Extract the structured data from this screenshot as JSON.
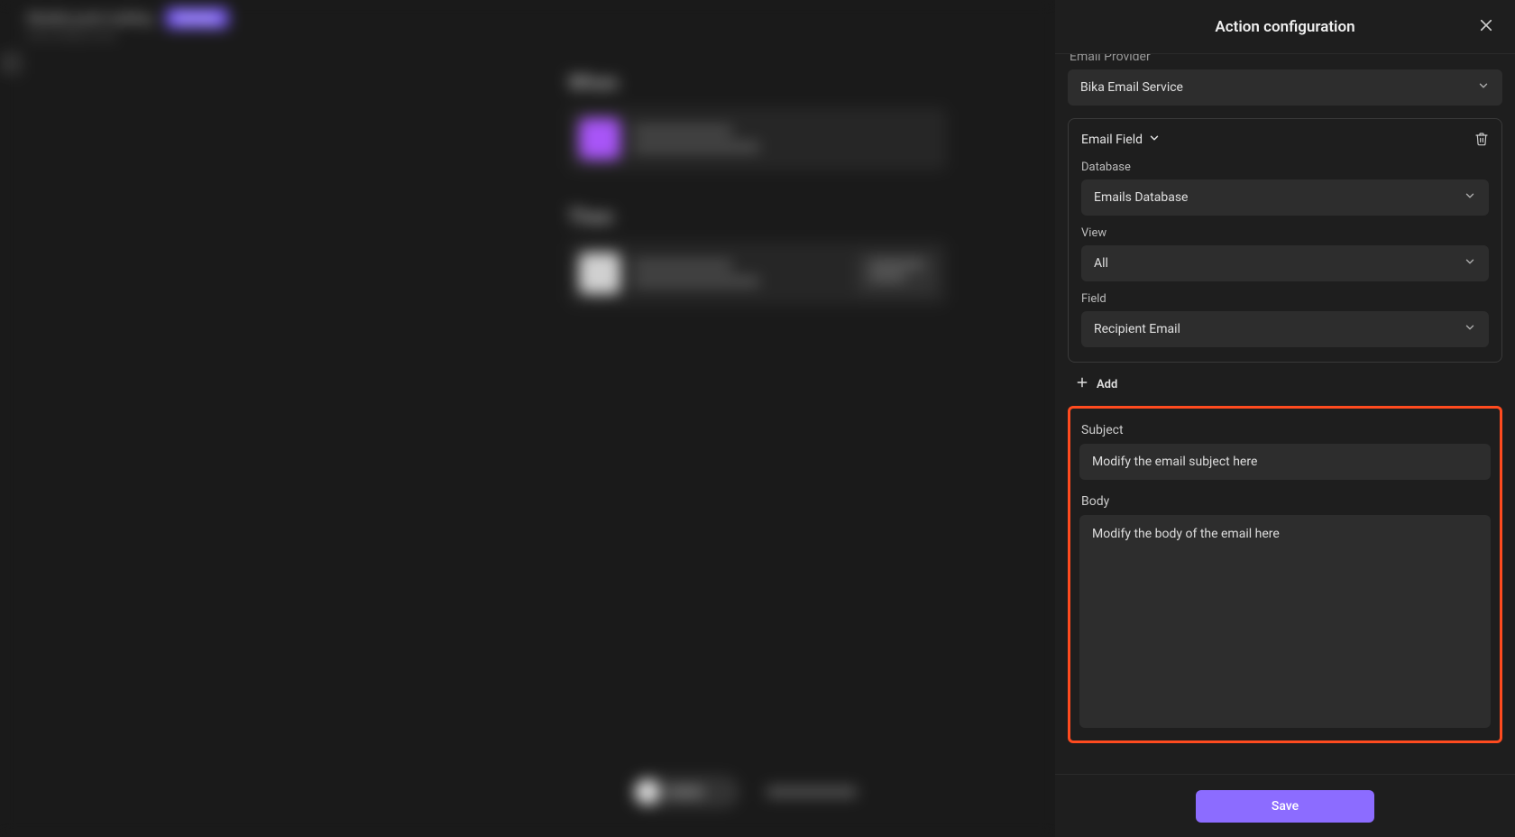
{
  "background": {
    "title": "Weekly push mailing",
    "badge": "Running",
    "subtitle": "Send weekly email",
    "section1": "When",
    "card1_line1": "Schedule Time",
    "card1_line2": "Every Friday",
    "section2": "Then",
    "card2_line1": "Send Email",
    "card2_line2": "Send Bulk Email",
    "card2_pill1": "Configure",
    "toggle": "ON",
    "bottom_text": "History"
  },
  "panel": {
    "title": "Action configuration",
    "email_provider_label": "Email Provider",
    "email_provider_value": "Bika Email Service",
    "field_box": {
      "header": "Email Field",
      "database_label": "Database",
      "database_value": "Emails Database",
      "view_label": "View",
      "view_value": "All",
      "field_label": "Field",
      "field_value": "Recipient Email"
    },
    "add_label": "Add",
    "subject_label": "Subject",
    "subject_value": "Modify the email subject here",
    "body_label": "Body",
    "body_value": "Modify the body of the email here",
    "save_label": "Save"
  }
}
